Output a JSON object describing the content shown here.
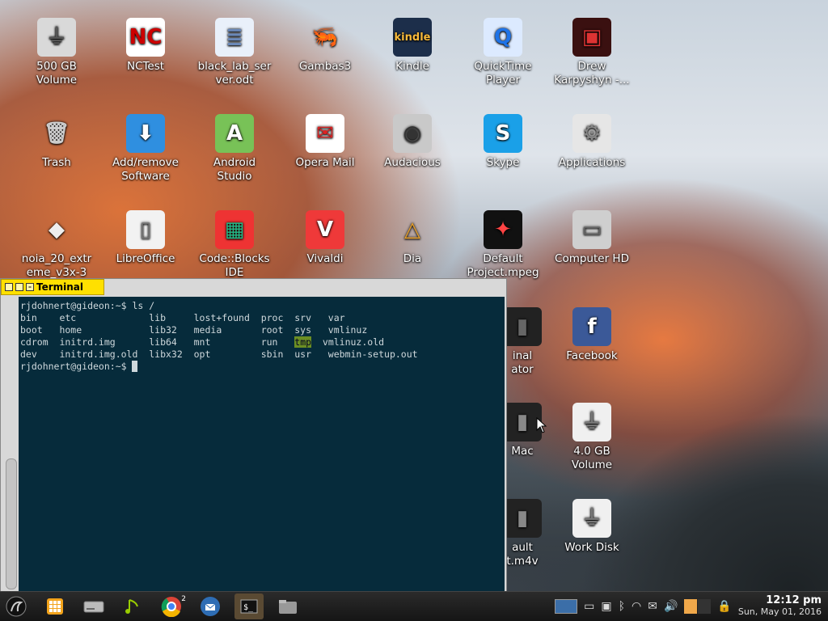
{
  "desktop": {
    "icons": [
      {
        "label": "500 GB\nVolume",
        "glyph": "⏚",
        "color": "#d9d9d9",
        "fg": "#555"
      },
      {
        "label": "NCTest",
        "glyph": "NC",
        "color": "#ffffff",
        "fg": "#c00"
      },
      {
        "label": "black_lab_ser\nver.odt",
        "glyph": "≣",
        "color": "#e9f0fa",
        "fg": "#6a88b8"
      },
      {
        "label": "Gambas3",
        "glyph": "🦐",
        "color": "rgba(0,0,0,0)",
        "fg": "#2d8bd9"
      },
      {
        "label": "Kindle",
        "glyph": "kindle",
        "color": "#1c2e4a",
        "fg": "#f7b93a"
      },
      {
        "label": "QuickTime\nPlayer",
        "glyph": "Q",
        "color": "#dceaff",
        "fg": "#1e73e8"
      },
      {
        "label": "Drew\nKarpyshyn -...",
        "glyph": "▣",
        "color": "#3a1010",
        "fg": "#d33"
      },
      {
        "label": "Trash",
        "glyph": "🗑",
        "color": "rgba(0,0,0,0)",
        "fg": "#ccc"
      },
      {
        "label": "Add/remove\nSoftware",
        "glyph": "⬇",
        "color": "#2f8fe0",
        "fg": "#fff"
      },
      {
        "label": "Android\nStudio",
        "glyph": "A",
        "color": "#78c257",
        "fg": "#fff"
      },
      {
        "label": "Opera Mail",
        "glyph": "✉",
        "color": "#ffffff",
        "fg": "#d22"
      },
      {
        "label": "Audacious",
        "glyph": "◉",
        "color": "#c9c9c9",
        "fg": "#333"
      },
      {
        "label": "Skype",
        "glyph": "S",
        "color": "#1aa0e8",
        "fg": "#fff"
      },
      {
        "label": "Applications",
        "glyph": "⚙",
        "color": "#e6e6e6",
        "fg": "#888"
      },
      {
        "label": "noia_20_extr\neme_v3x-3",
        "glyph": "◆",
        "color": "rgba(0,0,0,0)",
        "fg": "#eee"
      },
      {
        "label": "LibreOffice",
        "glyph": "▯",
        "color": "#f2f2f2",
        "fg": "#777"
      },
      {
        "label": "Code::Blocks\nIDE",
        "glyph": "▦",
        "color": "#e33",
        "fg": "#2b8"
      },
      {
        "label": "Vivaldi",
        "glyph": "V",
        "color": "#ef3939",
        "fg": "#fff"
      },
      {
        "label": "Dia",
        "glyph": "△",
        "color": "rgba(0,0,0,0)",
        "fg": "#e8a02a"
      },
      {
        "label": "Default\nProject.mpeg",
        "glyph": "✦",
        "color": "#111",
        "fg": "#f44"
      },
      {
        "label": "Computer HD",
        "glyph": "▭",
        "color": "#cfcfcf",
        "fg": "#666"
      },
      {
        "label": "inal\nator",
        "glyph": "▮",
        "color": "#222",
        "fg": "#666"
      },
      {
        "label": "Facebook",
        "glyph": "f",
        "color": "#3b5998",
        "fg": "#fff"
      },
      {
        "label": "Mac",
        "glyph": "▮",
        "color": "#222",
        "fg": "#888"
      },
      {
        "label": "4.0 GB\nVolume",
        "glyph": "⏚",
        "color": "#f0f0f0",
        "fg": "#777"
      },
      {
        "label": "ault\nt.m4v",
        "glyph": "▮",
        "color": "#222",
        "fg": "#888"
      },
      {
        "label": "Work Disk",
        "glyph": "⏚",
        "color": "#f0f0f0",
        "fg": "#777"
      }
    ]
  },
  "terminal": {
    "title": "Terminal",
    "lines": [
      "rjdohnert@gideon:~$ ls /",
      "bin    etc             lib     lost+found  proc  srv   var",
      "boot   home            lib32   media       root  sys   vmlinuz",
      "cdrom  initrd.img      lib64   mnt         run   ",
      "dev    initrd.img.old  libx32  opt         sbin  usr   webmin-setup.out",
      "rjdohnert@gideon:~$ "
    ],
    "tmp_entry": "tmp",
    "after_tmp": "  vmlinuz.old"
  },
  "taskbar": {
    "chrome_badge": "2",
    "clock_time": "12:12 pm",
    "clock_date": "Sun, May 01, 2016"
  },
  "colors": {
    "terminal_bg": "#062b3b",
    "titlebar": "#ffe000",
    "taskbar": "#1e1e1e"
  }
}
